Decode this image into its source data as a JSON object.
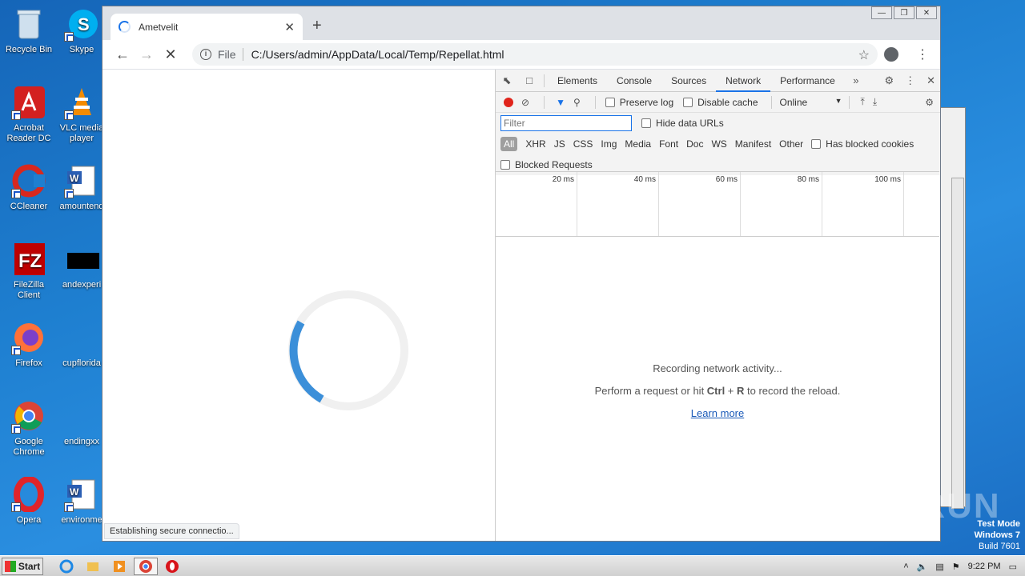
{
  "desktop": {
    "icons": [
      {
        "label": "Recycle Bin",
        "icon": "recycle-bin-icon"
      },
      {
        "label": "Skype",
        "icon": "skype-icon"
      },
      {
        "label": "Acrobat Reader DC",
        "icon": "acrobat-icon"
      },
      {
        "label": "VLC media player",
        "icon": "vlc-icon"
      },
      {
        "label": "CCleaner",
        "icon": "ccleaner-icon"
      },
      {
        "label": "amountend",
        "icon": "word-doc-icon"
      },
      {
        "label": "FileZilla Client",
        "icon": "filezilla-icon"
      },
      {
        "label": "andexperi",
        "icon": "black-file-icon"
      },
      {
        "label": "Firefox",
        "icon": "firefox-icon"
      },
      {
        "label": "cupflorida",
        "icon": "blank-file-icon"
      },
      {
        "label": "Google Chrome",
        "icon": "chrome-icon"
      },
      {
        "label": "endingxx",
        "icon": "blank-file-icon"
      },
      {
        "label": "Opera",
        "icon": "opera-icon"
      },
      {
        "label": "environme",
        "icon": "word-doc-icon"
      }
    ]
  },
  "browser": {
    "tab_title": "Ametvelit",
    "omnibox_scheme": "File",
    "url": "C:/Users/admin/AppData/Local/Temp/Repellat.html",
    "status": "Establishing secure connectio..."
  },
  "devtools": {
    "tabs": [
      "Elements",
      "Console",
      "Sources",
      "Network",
      "Performance"
    ],
    "active_tab": "Network",
    "preserve_log": "Preserve log",
    "disable_cache": "Disable cache",
    "throttle": "Online",
    "filter_placeholder": "Filter",
    "hide_data_urls": "Hide data URLs",
    "types": [
      "All",
      "XHR",
      "JS",
      "CSS",
      "Img",
      "Media",
      "Font",
      "Doc",
      "WS",
      "Manifest",
      "Other"
    ],
    "has_blocked_cookies": "Has blocked cookies",
    "blocked_requests": "Blocked Requests",
    "timeline_ticks": [
      "20 ms",
      "40 ms",
      "60 ms",
      "80 ms",
      "100 ms"
    ],
    "empty_line1": "Recording network activity...",
    "empty_line2_pre": "Perform a request or hit ",
    "empty_key1": "Ctrl",
    "empty_plus": " + ",
    "empty_key2": "R",
    "empty_line2_post": " to record the reload.",
    "learn_more": "Learn more"
  },
  "taskbar": {
    "start_label": "Start",
    "clock": "9:22 PM"
  },
  "overlay": {
    "watermark": "ANY RUN",
    "test_mode_line1": "Test Mode",
    "test_mode_line2": "Windows 7",
    "test_mode_line3": "Build 7601"
  },
  "colors": {
    "accent": "#1a73e8",
    "record": "#e0241b",
    "spinner": "#3b8fd9"
  }
}
